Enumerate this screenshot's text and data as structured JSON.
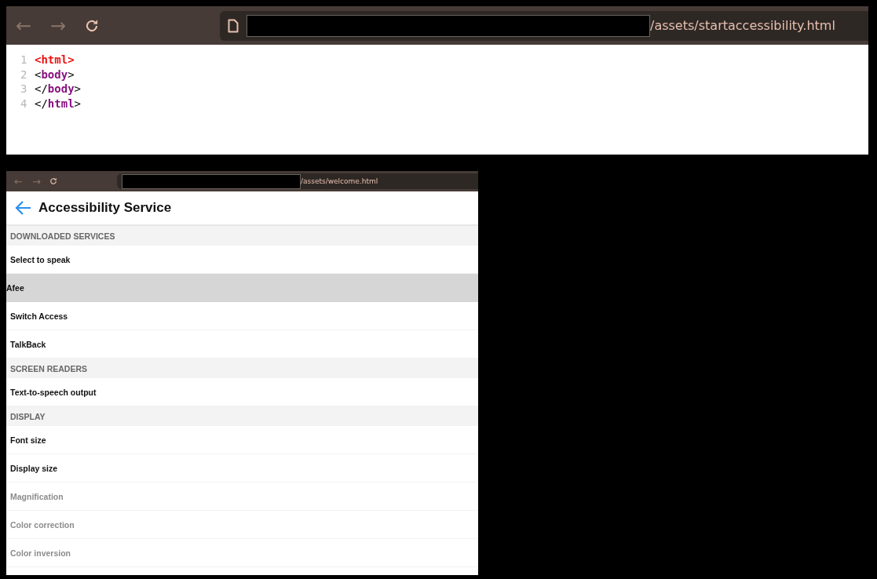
{
  "source_window": {
    "toolbar": {
      "back": "←",
      "forward": "→",
      "address_suffix": "/assets/startaccessibility.html"
    },
    "code_lines": [
      {
        "number": "1",
        "open": "<",
        "tag": "html",
        "close": ">",
        "error": true
      },
      {
        "number": "2",
        "open": "<",
        "tag": "body",
        "close": ">",
        "error": false
      },
      {
        "number": "3",
        "open": "</",
        "tag": "body",
        "close": ">",
        "error": false
      },
      {
        "number": "4",
        "open": "</",
        "tag": "html",
        "close": ">",
        "error": false
      }
    ]
  },
  "app_window": {
    "toolbar": {
      "back": "←",
      "forward": "→",
      "address_suffix": "/assets/welcome.html"
    },
    "title": "Accessibility Service",
    "rows": [
      {
        "kind": "header",
        "label": "DOWNLOADED SERVICES"
      },
      {
        "kind": "item",
        "label": "Select to speak",
        "selected": false,
        "dimmed": false
      },
      {
        "kind": "item",
        "label": "Afee",
        "selected": true,
        "dimmed": false
      },
      {
        "kind": "item",
        "label": "Switch Access",
        "selected": false,
        "dimmed": false
      },
      {
        "kind": "item",
        "label": "TalkBack",
        "selected": false,
        "dimmed": false
      },
      {
        "kind": "header",
        "label": "SCREEN READERS"
      },
      {
        "kind": "item",
        "label": "Text-to-speech output",
        "selected": false,
        "dimmed": false
      },
      {
        "kind": "header",
        "label": "DISPLAY"
      },
      {
        "kind": "item",
        "label": "Font size",
        "selected": false,
        "dimmed": false
      },
      {
        "kind": "item",
        "label": "Display size",
        "selected": false,
        "dimmed": false
      },
      {
        "kind": "item",
        "label": "Magnification",
        "selected": false,
        "dimmed": true
      },
      {
        "kind": "item",
        "label": "Color correction",
        "selected": false,
        "dimmed": true
      },
      {
        "kind": "item",
        "label": "Color inversion",
        "selected": false,
        "dimmed": true
      }
    ]
  }
}
